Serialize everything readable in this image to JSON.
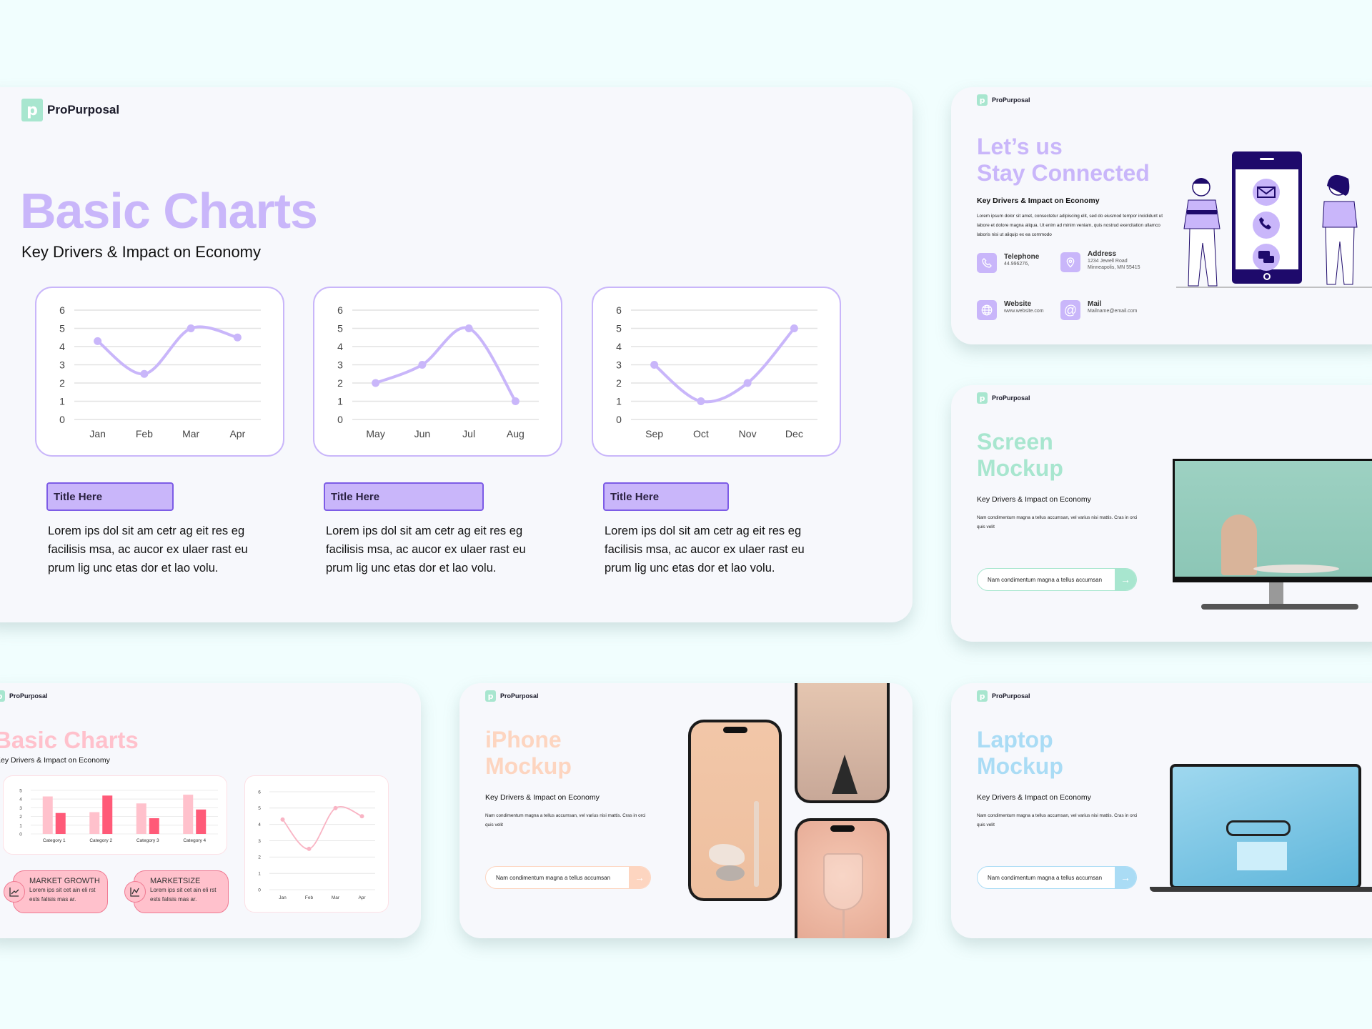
{
  "brand": "ProPurposal",
  "main_slide": {
    "title": "Basic Charts",
    "subtitle": "Key Drivers & Impact on Economy",
    "columns": [
      {
        "button": "Title Here",
        "text": "Lorem ips dol sit am cetr ag eit res eg facilisis msa, ac aucor ex ulaer rast eu prum lig unc etas dor et lao volu."
      },
      {
        "button": "Title Here",
        "text": "Lorem ips dol sit am cetr ag eit res eg facilisis msa, ac aucor ex ulaer rast eu prum lig unc etas dor et lao volu."
      },
      {
        "button": "Title Here",
        "text": "Lorem ips dol sit am cetr ag eit res eg facilisis msa, ac aucor ex ulaer rast eu prum lig unc etas dor et lao volu."
      }
    ],
    "accent": "#c9b6fa"
  },
  "contact_slide": {
    "title_line1": "Let’s us",
    "title_line2": "Stay Connected",
    "subtitle": "Key Drivers & Impact on Economy",
    "paragraph": "Lorem ipsum dolor sit amet, consectetur adipiscing elit, sed do eiusmod tempor incididunt ut labore et dolore magna aliqua. Ut enim ad minim veniam, quis nostrud exercitation ullamco laboris nisi ut aliquip ex ea commodo",
    "contacts": [
      {
        "label": "Telephone",
        "value": "44.996276,",
        "icon": "phone-icon"
      },
      {
        "label": "Address",
        "value": "1234 Jewell Road",
        "value2": "Minneapolis, MN 55415",
        "icon": "location-pin-icon"
      },
      {
        "label": "Website",
        "value": "www.website.com",
        "icon": "globe-icon"
      },
      {
        "label": "Mail",
        "value": "Mailname@email.com",
        "icon": "at-sign-icon"
      }
    ],
    "accent": "#c9b6fa"
  },
  "screen_slide": {
    "title_line1": "Screen",
    "title_line2": "Mockup",
    "subtitle": "Key Drivers & Impact on Economy",
    "paragraph": "Nam condimentum magna a tellus accumsan, vel varius nisi mattis. Cras in orci quis velit",
    "pill_text": "Nam condimentum magna a tellus accumsan",
    "accent": "#a8e6cf"
  },
  "pink_slide": {
    "title": "Basic Charts",
    "subtitle": "Key Drivers & Impact on Economy",
    "cards": [
      {
        "title": "MARKET GROWTH",
        "text": "Lorem ips sit cet ain eli rst ests falisis mas ar."
      },
      {
        "title": "MARKETSIZE",
        "text": "Lorem ips sit cet ain eli rst ests falisis mas ar."
      }
    ],
    "accent": "#ffc1cc"
  },
  "iphone_slide": {
    "title_line1": "iPhone",
    "title_line2": "Mockup",
    "subtitle": "Key Drivers & Impact on Economy",
    "paragraph": "Nam condimentum magna a tellus accumsan, vel varius nisi mattis. Cras in orci quis velit",
    "pill_text": "Nam condimentum magna a tellus accumsan",
    "accent": "#fdd5c0"
  },
  "laptop_slide": {
    "title_line1": "Laptop",
    "title_line2": "Mockup",
    "subtitle": "Key Drivers & Impact on Economy",
    "paragraph": "Nam condimentum magna a tellus accumsan, vel varius nisi mattis. Cras in orci quis velit",
    "pill_text": "Nam condimentum magna a tellus accumsan",
    "accent": "#aadcf5"
  },
  "chart_data": [
    {
      "type": "line",
      "categories": [
        "Jan",
        "Feb",
        "Mar",
        "Apr"
      ],
      "values": [
        4.3,
        2.5,
        5,
        4.5
      ],
      "ylim": [
        0,
        6
      ],
      "yticks": [
        0,
        1,
        2,
        3,
        4,
        5,
        6
      ],
      "grid": true,
      "color": "#c9b6fa"
    },
    {
      "type": "line",
      "categories": [
        "May",
        "Jun",
        "Jul",
        "Aug"
      ],
      "values": [
        2,
        3,
        5,
        1
      ],
      "ylim": [
        0,
        6
      ],
      "yticks": [
        0,
        1,
        2,
        3,
        4,
        5,
        6
      ],
      "grid": true,
      "color": "#c9b6fa"
    },
    {
      "type": "line",
      "categories": [
        "Sep",
        "Oct",
        "Nov",
        "Dec"
      ],
      "values": [
        3,
        1,
        2,
        5
      ],
      "ylim": [
        0,
        6
      ],
      "yticks": [
        0,
        1,
        2,
        3,
        4,
        5,
        6
      ],
      "grid": true,
      "color": "#c9b6fa"
    },
    {
      "type": "bar",
      "categories": [
        "Category 1",
        "Category 2",
        "Category 3",
        "Category 4"
      ],
      "series": [
        {
          "values": [
            4.3,
            2.5,
            3.5,
            4.5
          ],
          "color": "#ffc1cc"
        },
        {
          "values": [
            2.4,
            4.4,
            1.8,
            2.8
          ],
          "color": "#ff5a78"
        }
      ],
      "ylim": [
        0,
        5
      ],
      "yticks": [
        0,
        1,
        2,
        3,
        4,
        5
      ],
      "grid": true
    },
    {
      "type": "line",
      "categories": [
        "Jan",
        "Feb",
        "Mar",
        "Apr"
      ],
      "values": [
        4.3,
        2.5,
        5,
        4.5
      ],
      "ylim": [
        0,
        6
      ],
      "yticks": [
        0,
        1,
        2,
        3,
        4,
        5,
        6
      ],
      "grid": true,
      "color": "#f9b4c4"
    }
  ]
}
